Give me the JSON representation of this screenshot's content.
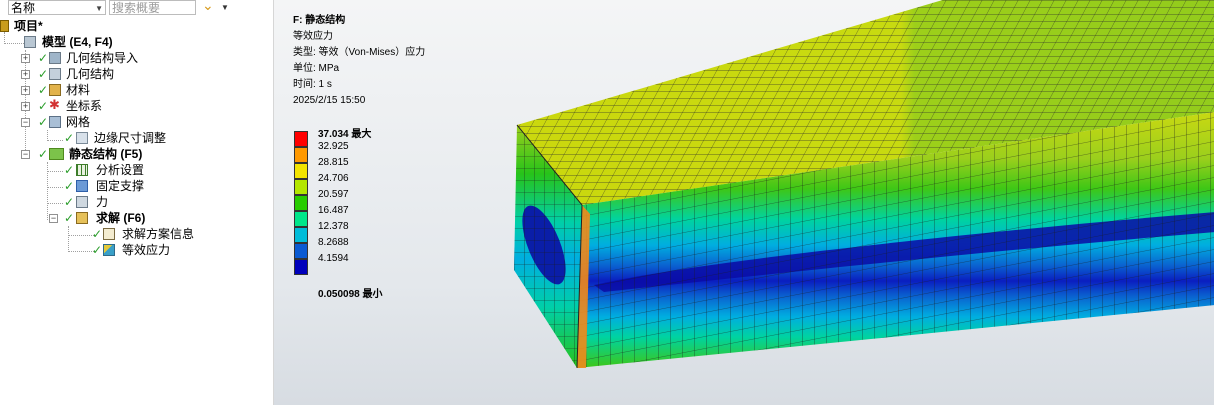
{
  "toolbar": {
    "name_select": "名称",
    "search_placeholder": "搜索概要",
    "filter_icon": "chevron-down-icon"
  },
  "tree": {
    "project": "项目*",
    "model": "模型 (E4, F4)",
    "geometry_import": "几何结构导入",
    "geometry": "几何结构",
    "materials": "材料",
    "coordinate_systems": "坐标系",
    "mesh": "网格",
    "edge_sizing": "边缘尺寸调整",
    "static_structural": "静态结构 (F5)",
    "analysis_settings": "分析设置",
    "fixed_support": "固定支撑",
    "force": "力",
    "solution": "求解 (F6)",
    "solution_information": "求解方案信息",
    "equivalent_stress": "等效应力"
  },
  "result_info": {
    "title": "F: 静态结构",
    "result_name": "等效应力",
    "type": "类型: 等效（Von-Mises）应力",
    "unit": "单位: MPa",
    "time": "时间: 1 s",
    "date": "2025/2/15 15:50"
  },
  "legend": {
    "max_label": "37.034 最大",
    "min_label": "0.050098 最小",
    "values": [
      "32.925",
      "28.815",
      "24.706",
      "20.597",
      "16.487",
      "12.378",
      "8.2688",
      "4.1594"
    ],
    "colors": [
      "#ff0000",
      "#ff9900",
      "#f3e400",
      "#b4e600",
      "#27cc00",
      "#00e68a",
      "#00bcd9",
      "#0a5ad2",
      "#0000bb"
    ]
  },
  "colors": {
    "accent": "#d79a1c",
    "check": "#2a9d2a"
  }
}
